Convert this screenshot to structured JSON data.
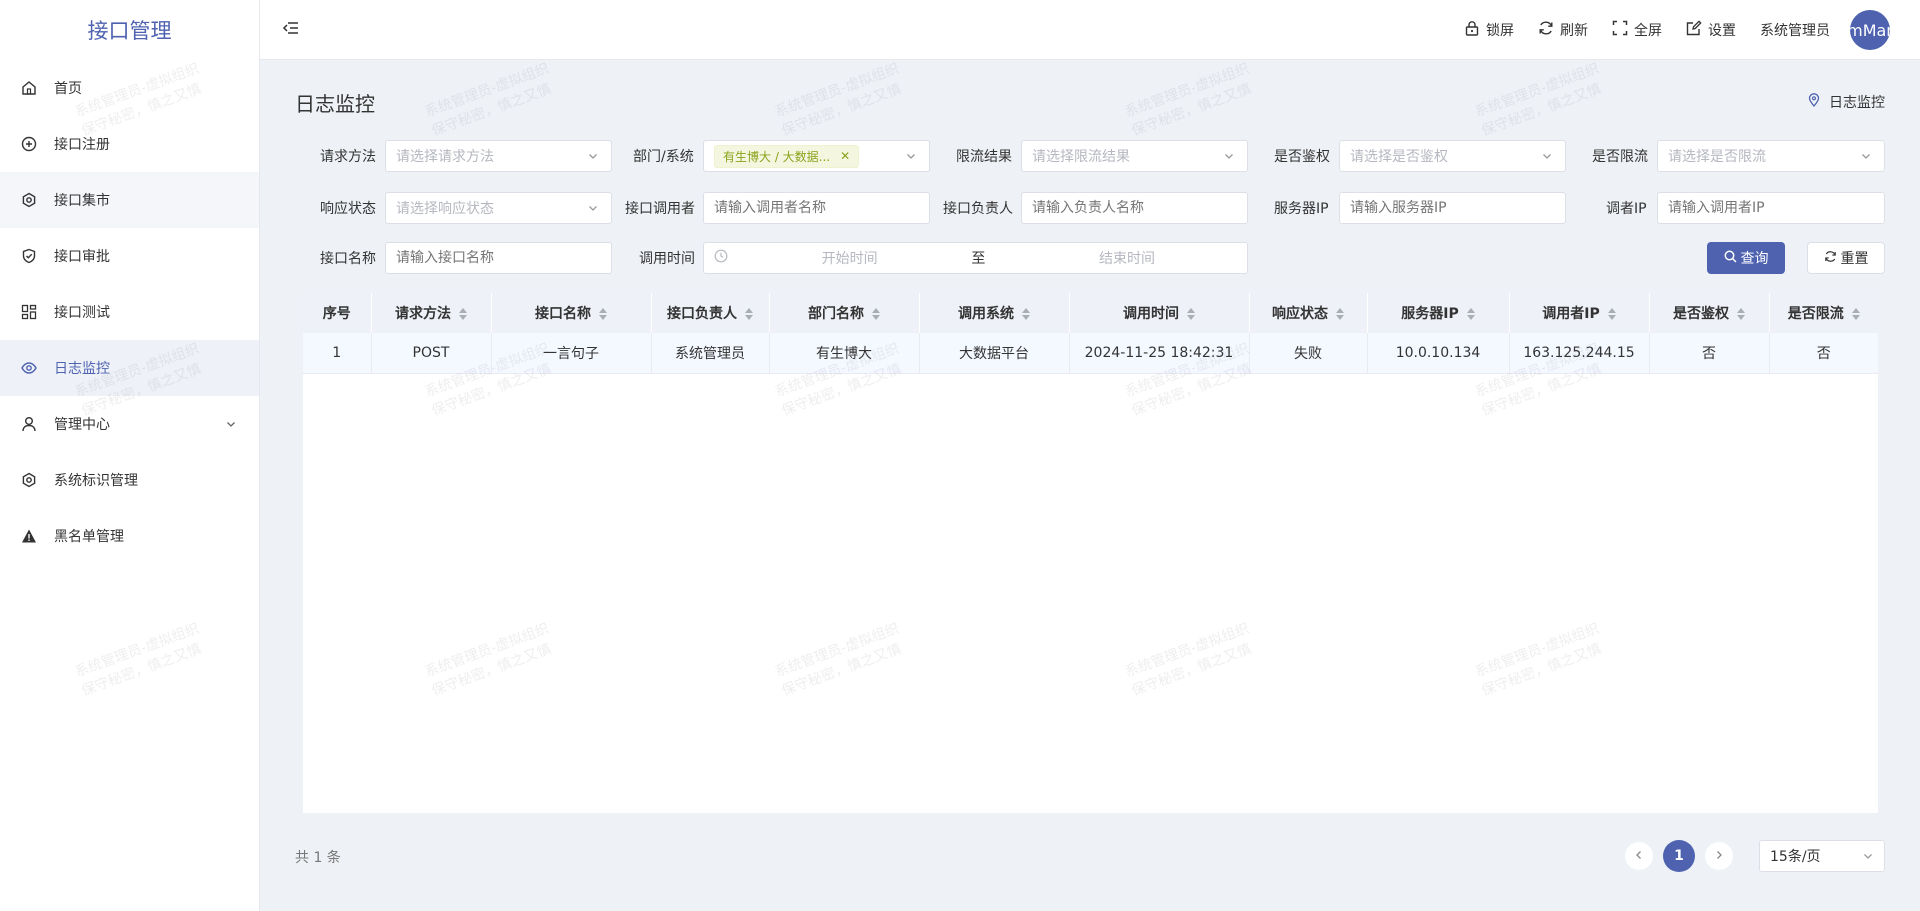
{
  "app": {
    "title": "接口管理"
  },
  "sidebar": {
    "items": [
      {
        "label": "首页",
        "icon": "home-icon"
      },
      {
        "label": "接口注册",
        "icon": "plus-circle-icon"
      },
      {
        "label": "接口集市",
        "icon": "gear-icon"
      },
      {
        "label": "接口审批",
        "icon": "shield-check-icon"
      },
      {
        "label": "接口测试",
        "icon": "dashboard-icon"
      },
      {
        "label": "日志监控",
        "icon": "eye-icon",
        "active": true
      },
      {
        "label": "管理中心",
        "icon": "user-icon",
        "expandable": true
      },
      {
        "label": "系统标识管理",
        "icon": "gear-icon"
      },
      {
        "label": "黑名单管理",
        "icon": "warning-icon"
      }
    ]
  },
  "header": {
    "tools": [
      {
        "label": "锁屏",
        "icon": "lock-icon"
      },
      {
        "label": "刷新",
        "icon": "refresh-icon"
      },
      {
        "label": "全屏",
        "icon": "fullscreen-icon"
      },
      {
        "label": "设置",
        "icon": "edit-icon"
      }
    ],
    "user_name": "系统管理员",
    "avatar_text": "mMar"
  },
  "page": {
    "title": "日志监控",
    "breadcrumb": "日志监控"
  },
  "filters": {
    "method": {
      "label": "请求方法",
      "placeholder": "请选择请求方法"
    },
    "dept": {
      "label": "部门/系统",
      "tag": "有生博大 / 大数据..."
    },
    "limit_result": {
      "label": "限流结果",
      "placeholder": "请选择限流结果"
    },
    "is_auth": {
      "label": "是否鉴权",
      "placeholder": "请选择是否鉴权"
    },
    "is_limit": {
      "label": "是否限流",
      "placeholder": "请选择是否限流"
    },
    "resp_status": {
      "label": "响应状态",
      "placeholder": "请选择响应状态"
    },
    "caller": {
      "label": "接口调用者",
      "placeholder": "请输入调用者名称"
    },
    "owner": {
      "label": "接口负责人",
      "placeholder": "请输入负责人名称"
    },
    "server_ip": {
      "label": "服务器IP",
      "placeholder": "请输入服务器IP"
    },
    "caller_ip": {
      "label": "调者IP",
      "placeholder": "请输入调用者IP"
    },
    "api_name": {
      "label": "接口名称",
      "placeholder": "请输入接口名称"
    },
    "call_time": {
      "label": "调用时间",
      "start_placeholder": "开始时间",
      "sep": "至",
      "end_placeholder": "结束时间"
    }
  },
  "buttons": {
    "query": "查询",
    "reset": "重置"
  },
  "table": {
    "columns": [
      "序号",
      "请求方法",
      "接口名称",
      "接口负责人",
      "部门名称",
      "调用系统",
      "调用时间",
      "响应状态",
      "服务器IP",
      "调用者IP",
      "是否鉴权",
      "是否限流"
    ],
    "rows": [
      [
        "1",
        "POST",
        "一言句子",
        "系统管理员",
        "有生博大",
        "大数据平台",
        "2024-11-25 18:42:31",
        "失败",
        "10.0.10.134",
        "163.125.244.15",
        "否",
        "否"
      ]
    ]
  },
  "footer": {
    "total": "共 1 条",
    "current_page": "1",
    "page_size": "15条/页"
  },
  "watermark": {
    "line1": "系统管理员-虚拟组织",
    "line2": "保守秘密，慎之又慎"
  }
}
